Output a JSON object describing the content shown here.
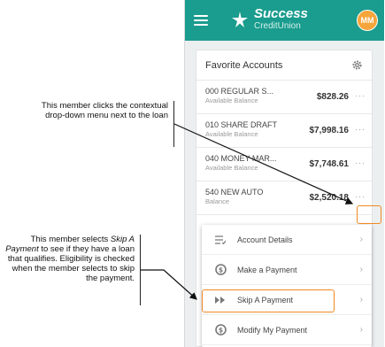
{
  "header": {
    "brand_name": "Success",
    "brand_sub": "CreditUnion",
    "avatar_initials": "MM",
    "accent_color": "#1a9c8e"
  },
  "card": {
    "title": "Favorite Accounts",
    "accounts": [
      {
        "name": "000 REGULAR S...",
        "sub": "Available Balance",
        "balance": "$828.26"
      },
      {
        "name": "010 SHARE DRAFT",
        "sub": "Available Balance",
        "balance": "$7,998.16"
      },
      {
        "name": "040 MONEY MAR...",
        "sub": "Available Balance",
        "balance": "$7,748.61"
      },
      {
        "name": "540 NEW AUTO",
        "sub": "Balance",
        "balance": "$2,520.18"
      }
    ],
    "more_label": "···"
  },
  "dropdown": {
    "items": [
      {
        "label": "Account Details",
        "icon": "list-icon"
      },
      {
        "label": "Make a Payment",
        "icon": "dollar-icon"
      },
      {
        "label": "Skip A Payment",
        "icon": "fast-forward-icon"
      },
      {
        "label": "Modify My Payment",
        "icon": "dollar-icon"
      }
    ]
  },
  "annotations": {
    "first": "This member clicks the contextual drop-down menu next to the loan",
    "second_prefix": "This member selects ",
    "second_em": "Skip A Payment",
    "second_suffix": " to see if they have a loan that qualifies. Eligibility is checked when the member selects to skip the payment."
  },
  "highlight_color": "#f08a24"
}
